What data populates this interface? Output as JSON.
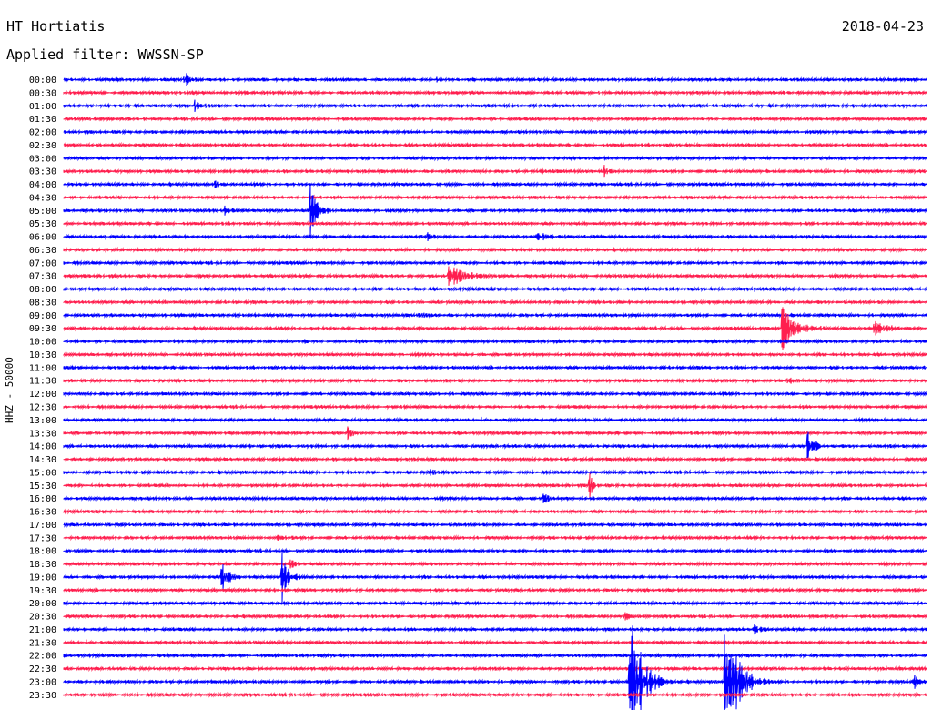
{
  "header": {
    "station": "HT Hortiatis",
    "date": "2018-04-23",
    "filter_label": "Applied filter: WWSSN-SP",
    "channel_label": "HHZ - 50000"
  },
  "colors": {
    "even_trace": "#0000ff",
    "odd_trace": "#ff1f4f"
  },
  "chart_data": {
    "type": "line",
    "title": "HT Hortiatis",
    "subtitle": "Applied filter: WWSSN-SP",
    "ylabel": "HHZ - 50000",
    "x_range_minutes": [
      0,
      30
    ],
    "categories": [
      "00:00",
      "00:30",
      "01:00",
      "01:30",
      "02:00",
      "02:30",
      "03:00",
      "03:30",
      "04:00",
      "04:30",
      "05:00",
      "05:30",
      "06:00",
      "06:30",
      "07:00",
      "07:30",
      "08:00",
      "08:30",
      "09:00",
      "09:30",
      "10:00",
      "10:30",
      "11:00",
      "11:30",
      "12:00",
      "12:30",
      "13:00",
      "13:30",
      "14:00",
      "14:30",
      "15:00",
      "15:30",
      "16:00",
      "16:30",
      "17:00",
      "17:30",
      "18:00",
      "18:30",
      "19:00",
      "19:30",
      "20:00",
      "20:30",
      "21:00",
      "21:30",
      "22:00",
      "22:30",
      "23:00",
      "23:30"
    ],
    "events": [
      {
        "row": "00:00",
        "minute": 4.2,
        "amp": 1.6,
        "dur": 0.6
      },
      {
        "row": "00:00",
        "minute": 7.0,
        "amp": 0.25,
        "dur": 0.3
      },
      {
        "row": "00:00",
        "minute": 13.0,
        "amp": 0.25,
        "dur": 0.3
      },
      {
        "row": "00:30",
        "minute": 6.3,
        "amp": 0.45,
        "dur": 0.2
      },
      {
        "row": "01:00",
        "minute": 4.6,
        "amp": 0.8,
        "dur": 0.6
      },
      {
        "row": "01:00",
        "minute": 5.1,
        "amp": 0.5,
        "dur": 0.4
      },
      {
        "row": "01:30",
        "minute": 28.9,
        "amp": 0.3,
        "dur": 0.3
      },
      {
        "row": "03:30",
        "minute": 13.0,
        "amp": 0.2,
        "dur": 0.8
      },
      {
        "row": "03:30",
        "minute": 16.6,
        "amp": 0.35,
        "dur": 1.0
      },
      {
        "row": "03:30",
        "minute": 18.8,
        "amp": 0.8,
        "dur": 0.5
      },
      {
        "row": "04:00",
        "minute": 5.3,
        "amp": 0.8,
        "dur": 0.4
      },
      {
        "row": "05:00",
        "minute": 5.6,
        "amp": 0.8,
        "dur": 0.6
      },
      {
        "row": "05:00",
        "minute": 8.6,
        "amp": 4.3,
        "dur": 0.8
      },
      {
        "row": "06:00",
        "minute": 12.7,
        "amp": 0.6,
        "dur": 0.4
      },
      {
        "row": "06:00",
        "minute": 16.5,
        "amp": 0.5,
        "dur": 2.2
      },
      {
        "row": "06:00",
        "minute": 20.9,
        "amp": 0.3,
        "dur": 0.6
      },
      {
        "row": "07:30",
        "minute": 4.7,
        "amp": 0.6,
        "dur": 0.3
      },
      {
        "row": "07:30",
        "minute": 13.4,
        "amp": 1.9,
        "dur": 2.0
      },
      {
        "row": "09:00",
        "minute": 12.2,
        "amp": 0.35,
        "dur": 1.5
      },
      {
        "row": "09:30",
        "minute": 25.0,
        "amp": 3.4,
        "dur": 1.6
      },
      {
        "row": "09:30",
        "minute": 28.2,
        "amp": 1.8,
        "dur": 1.2
      },
      {
        "row": "10:00",
        "minute": 8.4,
        "amp": 0.3,
        "dur": 0.3
      },
      {
        "row": "11:30",
        "minute": 25.2,
        "amp": 0.35,
        "dur": 1.0
      },
      {
        "row": "13:30",
        "minute": 9.9,
        "amp": 1.2,
        "dur": 0.5
      },
      {
        "row": "14:00",
        "minute": 25.9,
        "amp": 3.6,
        "dur": 0.6
      },
      {
        "row": "15:00",
        "minute": 12.8,
        "amp": 0.45,
        "dur": 0.4
      },
      {
        "row": "15:30",
        "minute": 18.3,
        "amp": 2.0,
        "dur": 0.4
      },
      {
        "row": "16:00",
        "minute": 16.7,
        "amp": 1.2,
        "dur": 0.5
      },
      {
        "row": "16:00",
        "minute": 20.9,
        "amp": 0.3,
        "dur": 0.3
      },
      {
        "row": "17:30",
        "minute": 7.4,
        "amp": 0.5,
        "dur": 1.2
      },
      {
        "row": "18:30",
        "minute": 7.9,
        "amp": 0.8,
        "dur": 0.5
      },
      {
        "row": "19:00",
        "minute": 5.5,
        "amp": 3.5,
        "dur": 0.7
      },
      {
        "row": "19:00",
        "minute": 7.6,
        "amp": 3.9,
        "dur": 0.8
      },
      {
        "row": "20:30",
        "minute": 19.5,
        "amp": 1.5,
        "dur": 0.4
      },
      {
        "row": "21:00",
        "minute": 24.0,
        "amp": 1.0,
        "dur": 0.6
      },
      {
        "row": "23:00",
        "minute": 19.7,
        "amp": 11.0,
        "dur": 1.6
      },
      {
        "row": "23:00",
        "minute": 23.0,
        "amp": 11.5,
        "dur": 1.6
      },
      {
        "row": "23:00",
        "minute": 29.6,
        "amp": 1.1,
        "dur": 0.4
      }
    ]
  }
}
